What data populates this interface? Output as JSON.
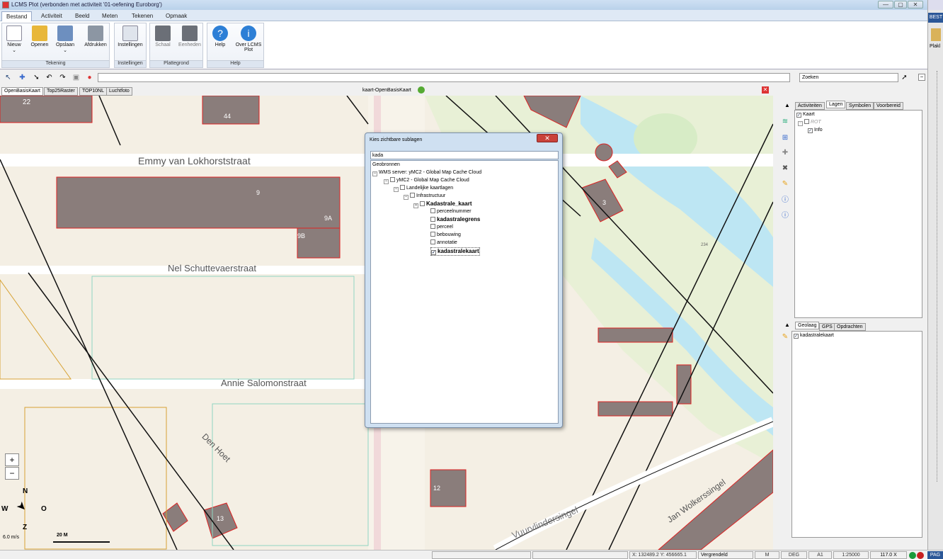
{
  "window": {
    "title": "LCMS Plot (verbonden met activiteit '01-oefening Euroborg')",
    "min": "—",
    "max": "▢",
    "close": "✕"
  },
  "menu": {
    "tabs": [
      "Bestand",
      "Activiteit",
      "Beeld",
      "Meten",
      "Tekenen",
      "Opmaak"
    ]
  },
  "ribbon": {
    "groups": [
      {
        "label": "Tekening",
        "buttons": [
          "Nieuw",
          "Openen",
          "Opslaan",
          "Afdrukken"
        ]
      },
      {
        "label": "Instellingen",
        "buttons": [
          "Instellingen"
        ]
      },
      {
        "label": "Plattegrond",
        "buttons": [
          "Schaal",
          "Eenheden"
        ]
      },
      {
        "label": "Help",
        "buttons": [
          "Help",
          "Over LCMS Plot"
        ]
      }
    ]
  },
  "toolbar": {
    "search_placeholder": "Zoeken"
  },
  "map": {
    "tabs": [
      "OpenBasisKaart",
      "Top25Raster",
      "TOP10NL",
      "Luchtfoto"
    ],
    "active_tab": "OpenBasisKaart",
    "title": "kaart-OpenBasisKaart",
    "streets": [
      "Emmy van Lokhorststraat",
      "Nel Schuttevaerstraat",
      "Annie Salomonstraat",
      "Den Hoet",
      "Vuurvlindersingel",
      "Jan Wolkerssingel"
    ],
    "building_labels": [
      "22",
      "44",
      "9",
      "9A",
      "9B",
      "3",
      "12",
      "13",
      "234"
    ],
    "compass": {
      "n": "N",
      "w": "W",
      "o": "O",
      "z": "Z",
      "wind": "6.0 m/s",
      "scale": "20 M"
    },
    "zoom_in": "+",
    "zoom_out": "−"
  },
  "dialog": {
    "title": "Kies zichtbare sublagen",
    "filter": "kada",
    "tree": [
      {
        "label": "Geobronnen",
        "level": 0,
        "checkbox": false
      },
      {
        "label": "WMS server: yMC2 - Global Map Cache Cloud",
        "level": 0,
        "checkbox": false,
        "expander": "−"
      },
      {
        "label": "yMC2 - Global Map Cache Cloud",
        "level": 1,
        "checkbox": true,
        "checked": false,
        "expander": "−"
      },
      {
        "label": "Landelijke kaartlagen",
        "level": 2,
        "checkbox": true,
        "checked": false,
        "expander": "−"
      },
      {
        "label": "Infrastructuur",
        "level": 3,
        "checkbox": true,
        "checked": false,
        "expander": "−"
      },
      {
        "label": "Kadastrale_kaart",
        "level": 4,
        "checkbox": true,
        "checked": false,
        "expander": "−",
        "bold": true
      },
      {
        "label": "perceelnummer",
        "level": 5,
        "checkbox": true,
        "checked": false
      },
      {
        "label": "kadastralegrens",
        "level": 5,
        "checkbox": true,
        "checked": false,
        "bold": true
      },
      {
        "label": "perceel",
        "level": 5,
        "checkbox": true,
        "checked": false
      },
      {
        "label": "bebouwing",
        "level": 5,
        "checkbox": true,
        "checked": false
      },
      {
        "label": "annotatie",
        "level": 5,
        "checkbox": true,
        "checked": false
      },
      {
        "label": "kadastralekaart",
        "level": 5,
        "checkbox": true,
        "checked": true,
        "bold": true
      }
    ]
  },
  "rpanel": {
    "tabs_top": [
      "Activiteiten",
      "Lagen",
      "Symbolen",
      "Voorbereid"
    ],
    "active_top": "Lagen",
    "layers": [
      {
        "label": "Kaart"
      },
      {
        "label": "ROT"
      },
      {
        "label": "Info"
      }
    ],
    "tabs_bottom": [
      "Geolaag",
      "GPS",
      "Opdrachten"
    ],
    "active_bottom": "Geolaag",
    "geolaag": [
      {
        "label": "kadastralekaart",
        "checked": true
      }
    ]
  },
  "rstrip": {
    "label": "BEST",
    "paste": "Plakl"
  },
  "status": {
    "coords": "X: 132489.2 Y: 456665.1",
    "lock": "Vergrendeld",
    "m": "M",
    "deg": "DEG",
    "paper": "A1",
    "scale": "1:25000",
    "zoom": "117.0 X",
    "page": "PAG"
  }
}
